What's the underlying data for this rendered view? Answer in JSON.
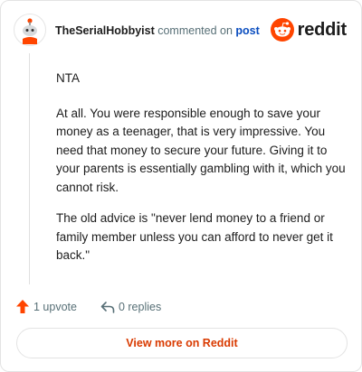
{
  "header": {
    "username": "TheSerialHobbyist",
    "action": "commented on",
    "post_link": "post",
    "brand": "reddit"
  },
  "comment": {
    "paragraphs": [
      "NTA",
      "At all. You were responsible enough to save your money as a teenager, that is very impressive. You need that money to secure your future. Giving it to your parents is essentially gambling with it, which you cannot risk.",
      "The old advice is \"never lend money to a friend or family member unless you can afford to never get it back.\""
    ]
  },
  "footer": {
    "upvotes": "1 upvote",
    "replies": "0 replies"
  },
  "cta": {
    "label": "View more on Reddit"
  },
  "colors": {
    "accent": "#ff4500",
    "link": "#0a4dbf",
    "cta_text": "#d93a00"
  }
}
